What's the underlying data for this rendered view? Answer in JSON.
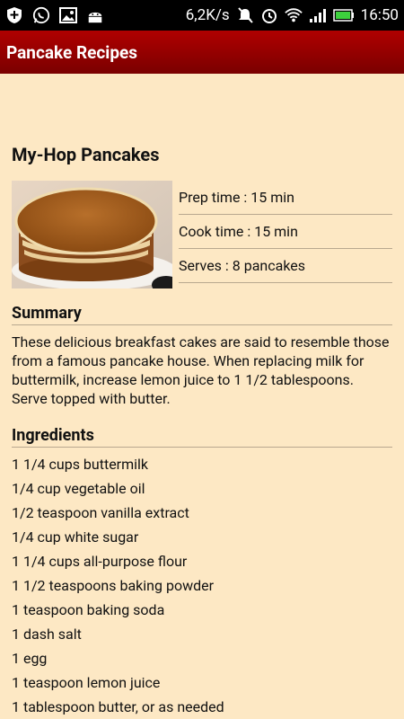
{
  "status_bar": {
    "speed": "6,2K/s",
    "time": "16:50"
  },
  "action_bar": {
    "title": "Pancake Recipes"
  },
  "recipe": {
    "title": "My-Hop Pancakes",
    "prep_time": "Prep time : 15 min",
    "cook_time": "Cook time : 15 min",
    "serves": "Serves : 8 pancakes",
    "summary_heading": "Summary",
    "summary": "These delicious breakfast cakes are said to resemble those from a famous pancake house. When replacing milk for buttermilk, increase lemon juice to 1 1/2 tablespoons. Serve topped with butter.",
    "ingredients_heading": "Ingredients",
    "ingredients": [
      "1 1/4 cups buttermilk",
      "1/4 cup vegetable oil",
      "1/2 teaspoon vanilla extract",
      "1/4 cup white sugar",
      "1 1/4 cups all-purpose flour",
      "1 1/2 teaspoons baking powder",
      "1 teaspoon baking soda",
      "1 dash salt",
      "1 egg",
      "1 teaspoon lemon juice",
      "1 tablespoon butter, or as needed"
    ]
  }
}
